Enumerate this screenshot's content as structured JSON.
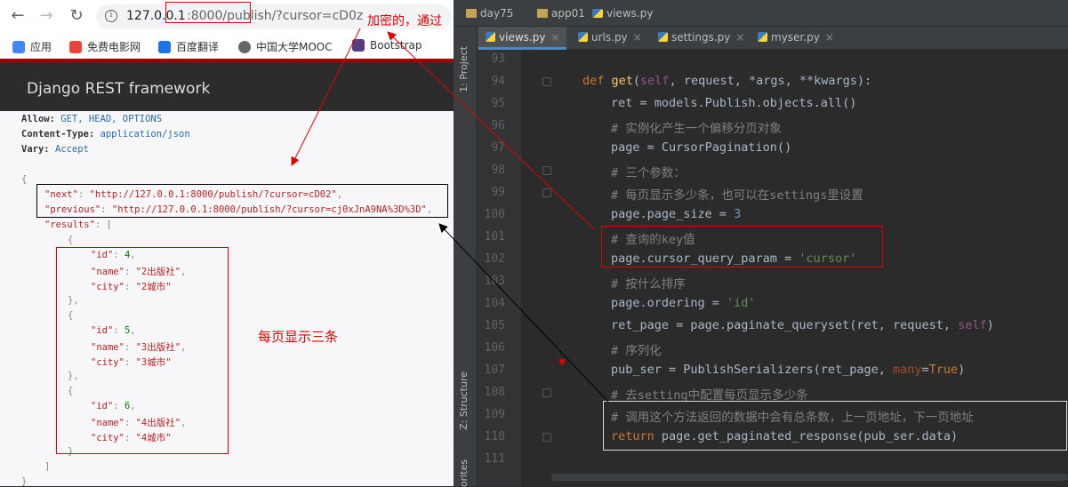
{
  "browser": {
    "url_host": "127.0.0.1",
    "url_path": ":8000/publish/?cursor=cD0z",
    "bookmarks": [
      "应用",
      "免费电影网",
      "百度翻译",
      "中国大学MOOC",
      "Bootstrap"
    ],
    "bookmark_colors": [
      "#4285f4",
      "#e8453c",
      "#1a73e8",
      "#666666",
      "#563d7c"
    ]
  },
  "drf": {
    "title": "Django REST framework",
    "headers": [
      {
        "key": "Allow:",
        "value": "GET, HEAD, OPTIONS"
      },
      {
        "key": "Content-Type:",
        "value": "application/json"
      },
      {
        "key": "Vary:",
        "value": "Accept"
      }
    ],
    "next_key": "\"next\"",
    "next_val": "\"http://127.0.0.1:8000/publish/?cursor=cD02\"",
    "prev_key": "\"previous\"",
    "prev_val": "\"http://127.0.0.1:8000/publish/?cursor=cj0xJnA9NA%3D%3D\"",
    "results_key": "\"results\"",
    "results": [
      {
        "id": "4",
        "name": "\"2出版社\"",
        "city": "\"2城市\""
      },
      {
        "id": "5",
        "name": "\"3出版社\"",
        "city": "\"3城市\""
      },
      {
        "id": "6",
        "name": "\"4出版社\"",
        "city": "\"4城市\""
      }
    ]
  },
  "annotations": {
    "encrypted_note": "加密的，通过",
    "page_note": "每页显示三条"
  },
  "ide": {
    "breadcrumbs": [
      "day75",
      "app01",
      "views.py"
    ],
    "tabs": [
      {
        "label": "views.py",
        "active": true
      },
      {
        "label": "urls.py",
        "active": false
      },
      {
        "label": "settings.py",
        "active": false
      },
      {
        "label": "myser.py",
        "active": false
      }
    ],
    "sidebar": {
      "project": "1: Project",
      "structure": "Z: Structure",
      "favorites": "orites"
    },
    "line_numbers": [
      "93",
      "94",
      "95",
      "96",
      "97",
      "98",
      "99",
      "100",
      "101",
      "102",
      "103",
      "104",
      "105",
      "106",
      "107",
      "108",
      "109",
      "110",
      "111"
    ]
  }
}
